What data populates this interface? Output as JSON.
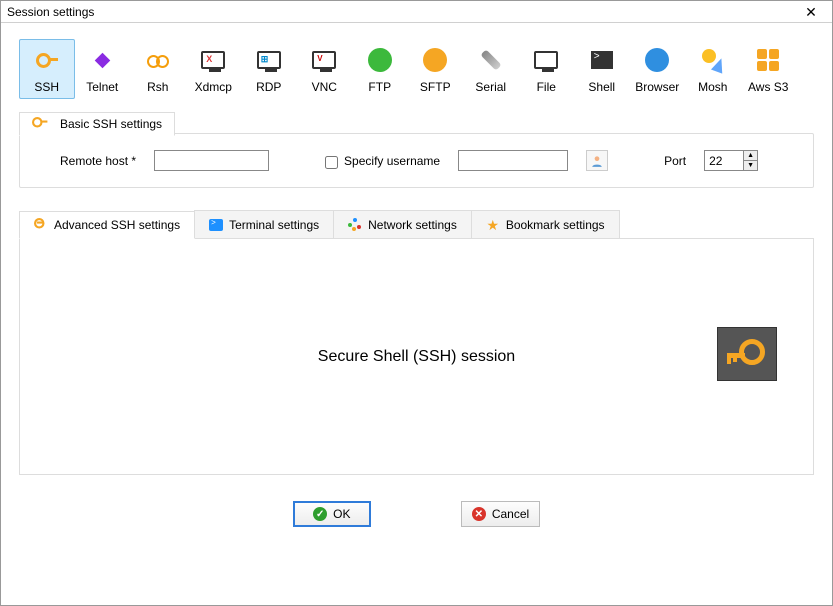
{
  "window": {
    "title": "Session settings"
  },
  "protocols": [
    {
      "label": "SSH"
    },
    {
      "label": "Telnet"
    },
    {
      "label": "Rsh"
    },
    {
      "label": "Xdmcp"
    },
    {
      "label": "RDP"
    },
    {
      "label": "VNC"
    },
    {
      "label": "FTP"
    },
    {
      "label": "SFTP"
    },
    {
      "label": "Serial"
    },
    {
      "label": "File"
    },
    {
      "label": "Shell"
    },
    {
      "label": "Browser"
    },
    {
      "label": "Mosh"
    },
    {
      "label": "Aws S3"
    }
  ],
  "basic": {
    "tab_label": "Basic SSH settings",
    "remote_host_label": "Remote host *",
    "remote_host_value": "",
    "specify_username_label": "Specify username",
    "specify_username_checked": false,
    "username_value": "",
    "port_label": "Port",
    "port_value": "22"
  },
  "tabs": {
    "advanced": "Advanced SSH settings",
    "terminal": "Terminal settings",
    "network": "Network settings",
    "bookmark": "Bookmark settings"
  },
  "panel": {
    "description": "Secure Shell (SSH) session"
  },
  "buttons": {
    "ok": "OK",
    "cancel": "Cancel"
  }
}
